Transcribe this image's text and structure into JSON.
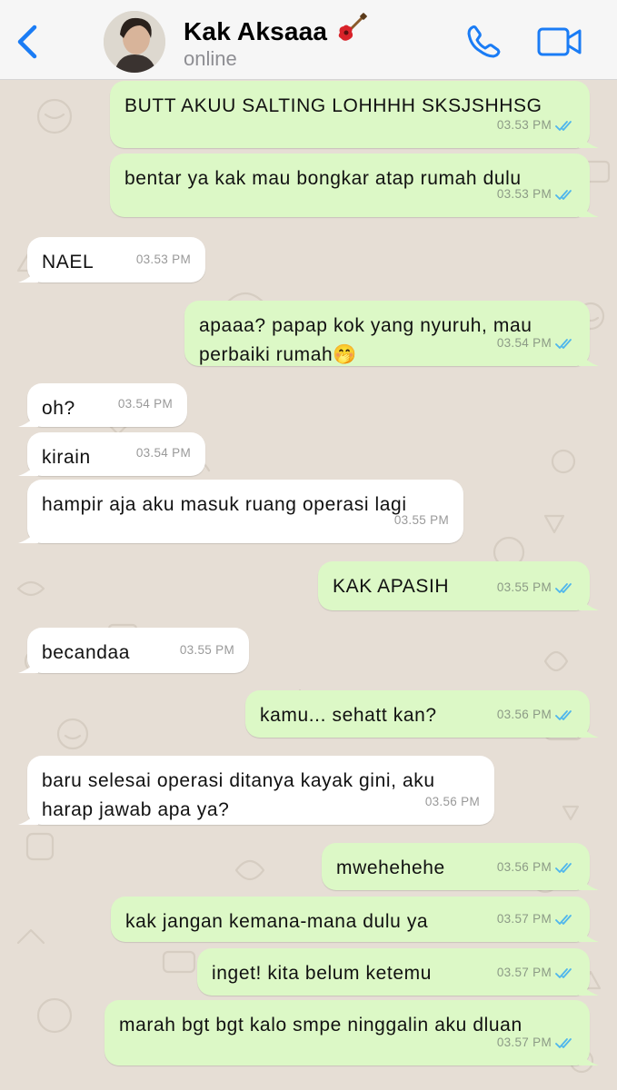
{
  "header": {
    "back_icon": "chevron-left-icon",
    "contact_name": "Kak Aksaaa",
    "name_emoji": "guitar-icon",
    "status": "online",
    "call_icon": "phone-icon",
    "video_icon": "video-camera-icon",
    "accent_color": "#1a7cf5"
  },
  "messages": [
    {
      "dir": "out",
      "lines": [
        "BUTT AKUU SALTING LOHHHH SKSJSHHSG"
      ],
      "time": "03.53 PM",
      "read": true
    },
    {
      "dir": "out",
      "lines": [
        "bentar ya kak mau bongkar atap rumah dulu"
      ],
      "time": "03.53 PM",
      "read": true
    },
    {
      "dir": "in",
      "lines": [
        "NAEL"
      ],
      "time": "03.53 PM"
    },
    {
      "dir": "out",
      "lines": [
        "apaaa? papap kok yang nyuruh, mau",
        "perbaiki rumah🤭"
      ],
      "time": "03.54 PM",
      "read": true
    },
    {
      "dir": "in",
      "lines": [
        "oh?"
      ],
      "time": "03.54 PM"
    },
    {
      "dir": "in",
      "lines": [
        "kirain"
      ],
      "time": "03.54 PM"
    },
    {
      "dir": "in",
      "lines": [
        "hampir aja aku masuk ruang operasi lagi"
      ],
      "time": "03.55 PM"
    },
    {
      "dir": "out",
      "lines": [
        "KAK APASIH"
      ],
      "time": "03.55 PM",
      "read": true
    },
    {
      "dir": "in",
      "lines": [
        "becandaa"
      ],
      "time": "03.55 PM"
    },
    {
      "dir": "out",
      "lines": [
        "kamu... sehatt kan?"
      ],
      "time": "03.56 PM",
      "read": true
    },
    {
      "dir": "in",
      "lines": [
        "baru selesai operasi ditanya kayak gini, aku",
        "harap jawab apa ya?"
      ],
      "time": "03.56 PM"
    },
    {
      "dir": "out",
      "lines": [
        "mwehehehe"
      ],
      "time": "03.56 PM",
      "read": true
    },
    {
      "dir": "out",
      "lines": [
        "kak jangan kemana-mana dulu ya"
      ],
      "time": "03.57 PM",
      "read": true
    },
    {
      "dir": "out",
      "lines": [
        "inget! kita belum ketemu"
      ],
      "time": "03.57 PM",
      "read": true
    },
    {
      "dir": "out",
      "lines": [
        "marah bgt bgt kalo smpe ninggalin aku dluan"
      ],
      "time": "03.57 PM",
      "read": true
    }
  ],
  "colors": {
    "outgoing_bubble": "#dcf8c6",
    "incoming_bubble": "#ffffff",
    "chat_background": "#e6ded5",
    "read_ticks": "#4fb6ec"
  }
}
